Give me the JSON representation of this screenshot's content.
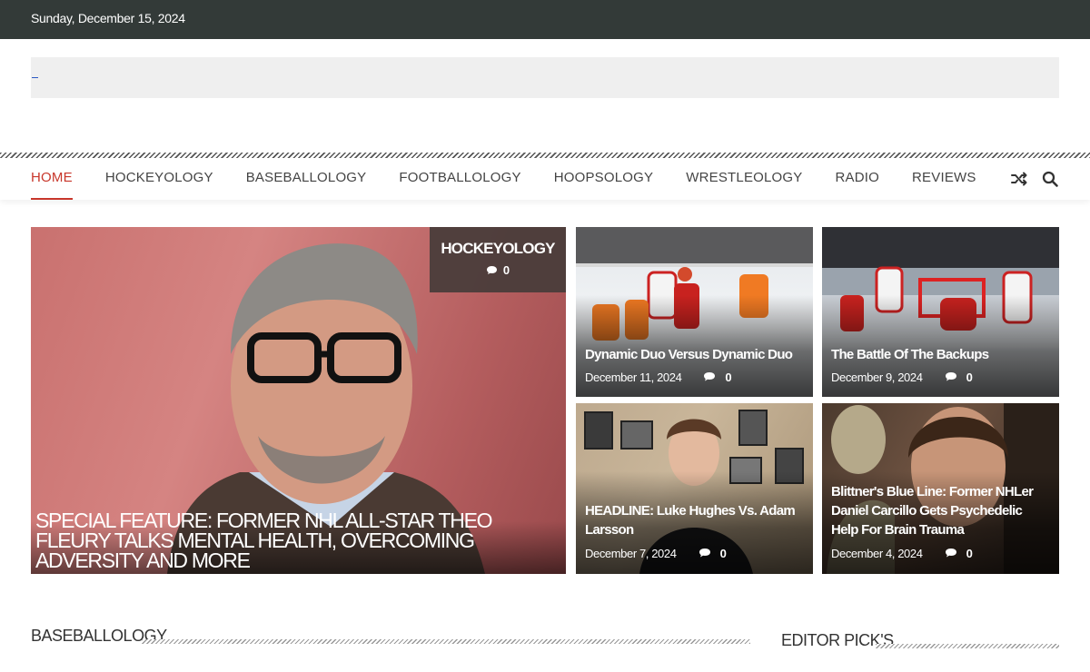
{
  "topbar": {
    "date": "Sunday, December 15, 2024"
  },
  "nav": {
    "items": [
      {
        "label": "HOME",
        "active": true
      },
      {
        "label": "HOCKEYOLOGY",
        "active": false
      },
      {
        "label": "BASEBALLOLOGY",
        "active": false
      },
      {
        "label": "FOOTBALLOLOGY",
        "active": false
      },
      {
        "label": "HOOPSOLOGY",
        "active": false
      },
      {
        "label": "WRESTLEOLOGY",
        "active": false
      },
      {
        "label": "RADIO",
        "active": false
      },
      {
        "label": "REVIEWS",
        "active": false
      }
    ],
    "icons": [
      "shuffle-icon",
      "search-icon"
    ]
  },
  "featured": {
    "category": "HOCKEYOLOGY",
    "comments": "0",
    "title": "SPECIAL FEATURE: FORMER NHL ALL-STAR THEO FLEURY TALKS MENTAL HEALTH, OVERCOMING ADVERSITY AND MORE"
  },
  "tiles": [
    {
      "title": "Dynamic Duo Versus Dynamic Duo",
      "date": "December 11, 2024",
      "comments": "0"
    },
    {
      "title": "The Battle Of The Backups",
      "date": "December 9, 2024",
      "comments": "0"
    },
    {
      "title": "HEADLINE: Luke Hughes Vs. Adam Larsson",
      "date": "December 7, 2024",
      "comments": "0"
    },
    {
      "title": "Blittner's Blue Line: Former NHLer Daniel Carcillo Gets Psychedelic Help For Brain Trauma",
      "date": "December 4, 2024",
      "comments": "0"
    }
  ],
  "sections": {
    "left": "BASEBALLOLOGY",
    "right": "EDITOR PICK'S"
  },
  "colors": {
    "topbar": "#333a38",
    "accent": "#c8372b"
  }
}
